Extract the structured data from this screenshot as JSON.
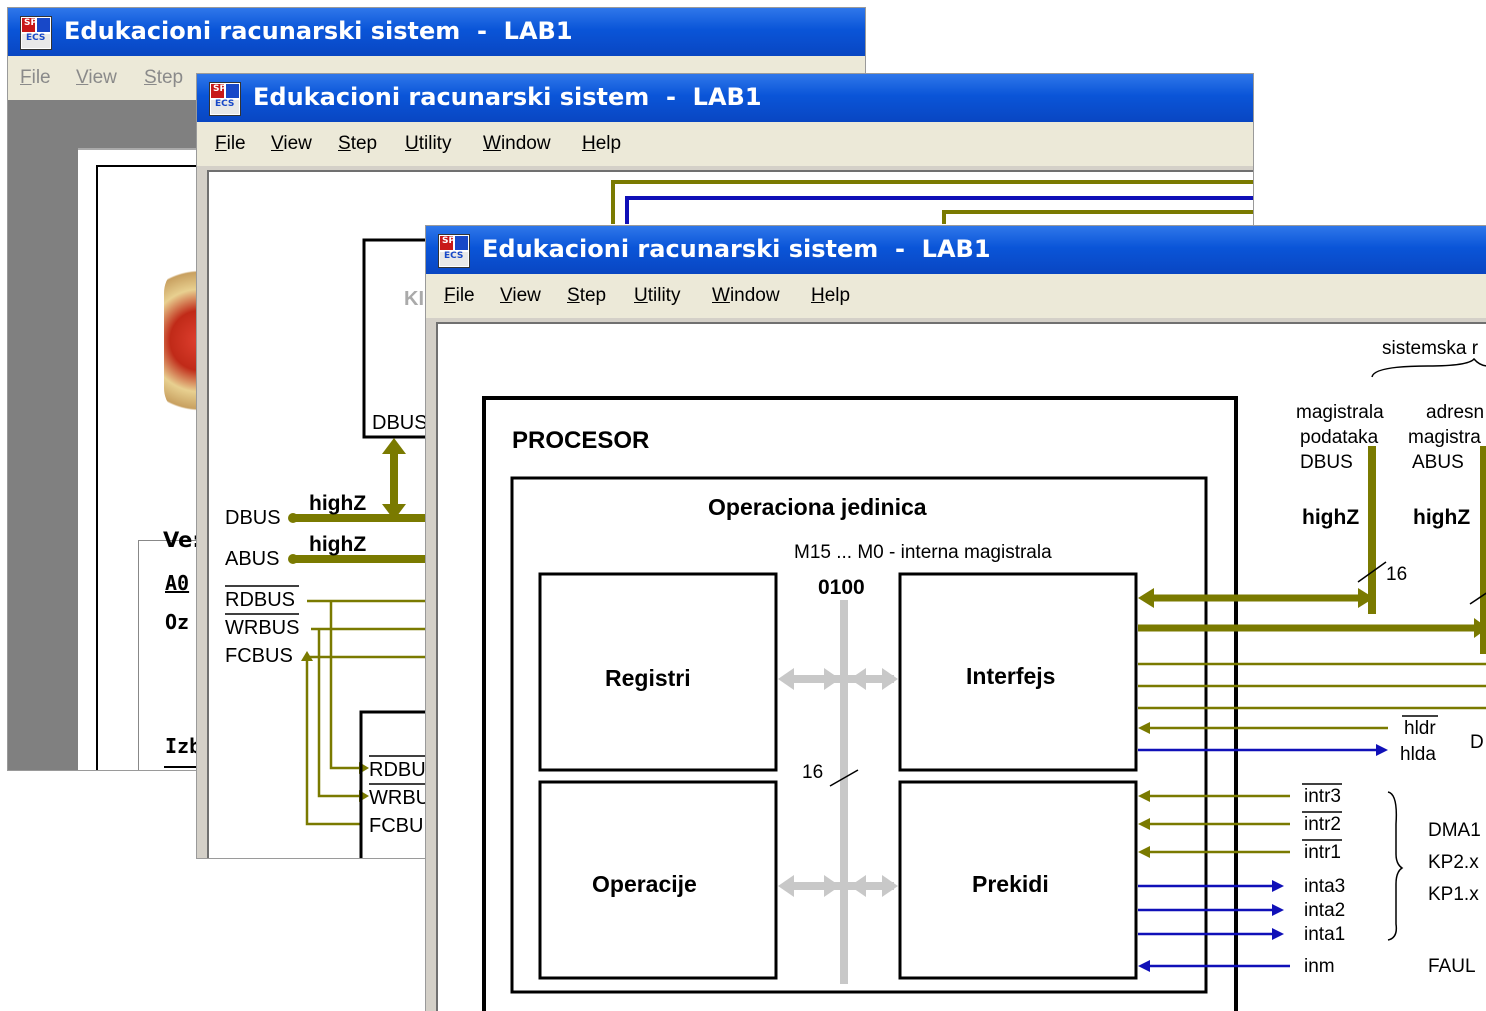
{
  "window_title": "Edukacioni racunarski sistem  -  LAB1",
  "menu": [
    "File",
    "View",
    "Step",
    "Utility",
    "Window",
    "Help"
  ],
  "back_menu": [
    "File",
    "View",
    "Step"
  ],
  "back_labels": {
    "ve": "Ve:",
    "ao": "A0",
    "oz": "Oz",
    "izb": "Izb"
  },
  "mid": {
    "kp_label": "KI",
    "dbus_box": "DBUS",
    "signals": [
      "DBUS",
      "ABUS",
      "RDBUS",
      "WRBUS",
      "FCBUS"
    ],
    "highz": "highZ",
    "lower_box": [
      "RDBU",
      "WRBU",
      "FCBU"
    ]
  },
  "front": {
    "sistemska": "sistemska r",
    "bus_labels": [
      [
        "magistrala",
        "podataka",
        "DBUS"
      ],
      [
        "adresn",
        "magistra",
        "ABUS"
      ]
    ],
    "highz": "highZ",
    "width16": "16",
    "procesor": "PROCESOR",
    "operaciona": "Operaciona jedinica",
    "internal_bus": "M15 ... M0  -  interna magistrala",
    "bus_value": "0100",
    "registri": "Registri",
    "interfejs": "Interfejs",
    "operacije": "Operacije",
    "prekidi": "Prekidi",
    "hldr": "hldr",
    "hlda": "hlda",
    "d": "D",
    "intr": [
      "intr3",
      "intr2",
      "intr1"
    ],
    "inta": [
      "inta3",
      "inta2",
      "inta1"
    ],
    "inm": "inm",
    "devices": [
      "DMA1",
      "KP2.x",
      "KP1.x"
    ],
    "fault": "FAUL"
  },
  "colors": {
    "olive": "#7a7a00",
    "blue": "#1010b8",
    "gray_bus": "#c8c8c8",
    "titlebar": "#0a55d8"
  }
}
